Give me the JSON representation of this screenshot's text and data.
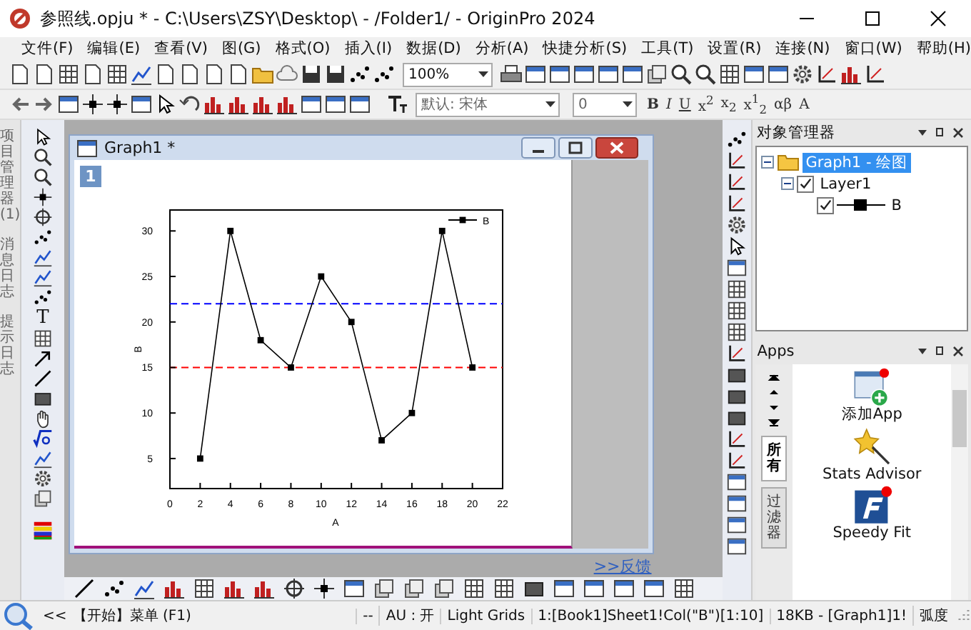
{
  "window": {
    "title": "参照线.opju * - C:\\Users\\ZSY\\Desktop\\ - /Folder1/ - OriginPro 2024"
  },
  "menu": [
    "文件(F)",
    "编辑(E)",
    "查看(V)",
    "图(G)",
    "格式(O)",
    "插入(I)",
    "数据(D)",
    "分析(A)",
    "快捷分析(S)",
    "工具(T)",
    "设置(R)",
    "连接(N)",
    "窗口(W)",
    "帮助(H)"
  ],
  "toolbar1": {
    "zoom": "100%"
  },
  "toolbar2": {
    "font": "默认: 宋体",
    "size": "0",
    "format_buttons": [
      "B",
      "I",
      "U",
      "x$^{2}$",
      "x$_{2}$",
      "x$^{1}$$_{2}$",
      "αβ",
      "A"
    ]
  },
  "side_tabs": [
    {
      "label": "项目管理器 (1)"
    },
    {
      "label": "消息日志"
    },
    {
      "label": "提示日志"
    }
  ],
  "tools": {
    "text_tool": "T"
  },
  "graph_window": {
    "title": "Graph1 *",
    "layer": "1",
    "chart_data": {
      "type": "line",
      "xlabel": "A",
      "ylabel": "B",
      "x": [
        2,
        4,
        6,
        8,
        10,
        12,
        14,
        16,
        18,
        20
      ],
      "series": [
        {
          "name": "B",
          "color": "#000000",
          "marker": "square",
          "values": [
            5,
            30,
            18,
            15,
            25,
            20,
            7,
            10,
            30,
            15
          ]
        }
      ],
      "xlim": [
        0,
        22
      ],
      "ylim": [
        1.7,
        32.3
      ],
      "xticks": [
        0,
        2,
        4,
        6,
        8,
        10,
        12,
        14,
        16,
        18,
        20,
        22
      ],
      "yticks": [
        5,
        10,
        15,
        20,
        25,
        30
      ],
      "ref_lines": [
        {
          "axis": "y",
          "value": 22,
          "color": "#0000ff"
        },
        {
          "axis": "y",
          "value": 15,
          "color": "#ff0000"
        }
      ]
    }
  },
  "feedback_link": ">>反馈",
  "object_manager": {
    "title": "对象管理器",
    "tree": [
      {
        "label": "Graph1 - 绘图",
        "selected": true,
        "expanded": true,
        "children": [
          {
            "label": "Layer1",
            "checked": true,
            "expanded": true,
            "children": [
              {
                "label": "B",
                "checked": true
              }
            ]
          }
        ]
      }
    ]
  },
  "apps": {
    "title": "Apps",
    "tabs": [
      {
        "label": "所有",
        "selected": true
      },
      {
        "label": "过滤器",
        "selected": false
      }
    ],
    "items": [
      {
        "label": "添加App"
      },
      {
        "label": "Stats Advisor"
      },
      {
        "label": "Speedy Fit"
      }
    ]
  },
  "status_bar": {
    "hint_toggle": "<<",
    "hint": "【开始】菜单 (F1)",
    "fields": [
      "--",
      "AU : 开",
      "Light Grids",
      "1:[Book1]Sheet1!Col(\"B\")[1:10]",
      "18KB - [Graph1]1!",
      "弧度"
    ]
  }
}
